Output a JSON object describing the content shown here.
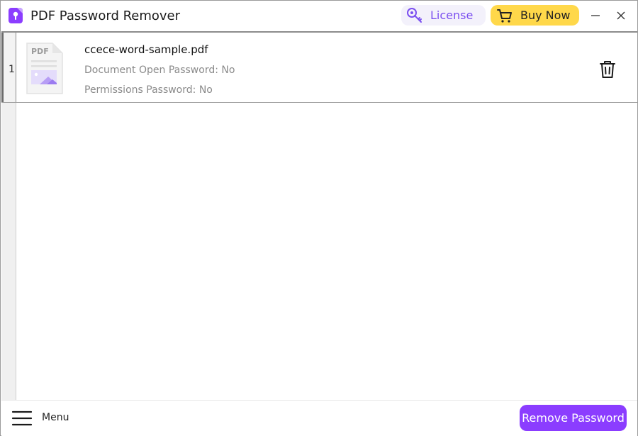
{
  "app": {
    "title": "PDF Password Remover",
    "accent_color": "#8b3dff",
    "icon": "pdf-lock-app-icon"
  },
  "header": {
    "license_label": "License",
    "license_icon": "key-icon",
    "buy_label": "Buy Now",
    "buy_icon": "cart-icon",
    "buy_color": "#ffd84a",
    "minimize_icon": "minimize-icon",
    "close_icon": "close-icon"
  },
  "files": [
    {
      "index": "1",
      "name": "ccece-word-sample.pdf",
      "thumb_label": "PDF",
      "open_password": "Document Open Password: No",
      "permissions_password": "Permissions Password: No",
      "delete_icon": "trash-icon"
    }
  ],
  "footer": {
    "menu_label": "Menu",
    "menu_icon": "hamburger-icon",
    "remove_label": "Remove Password"
  }
}
